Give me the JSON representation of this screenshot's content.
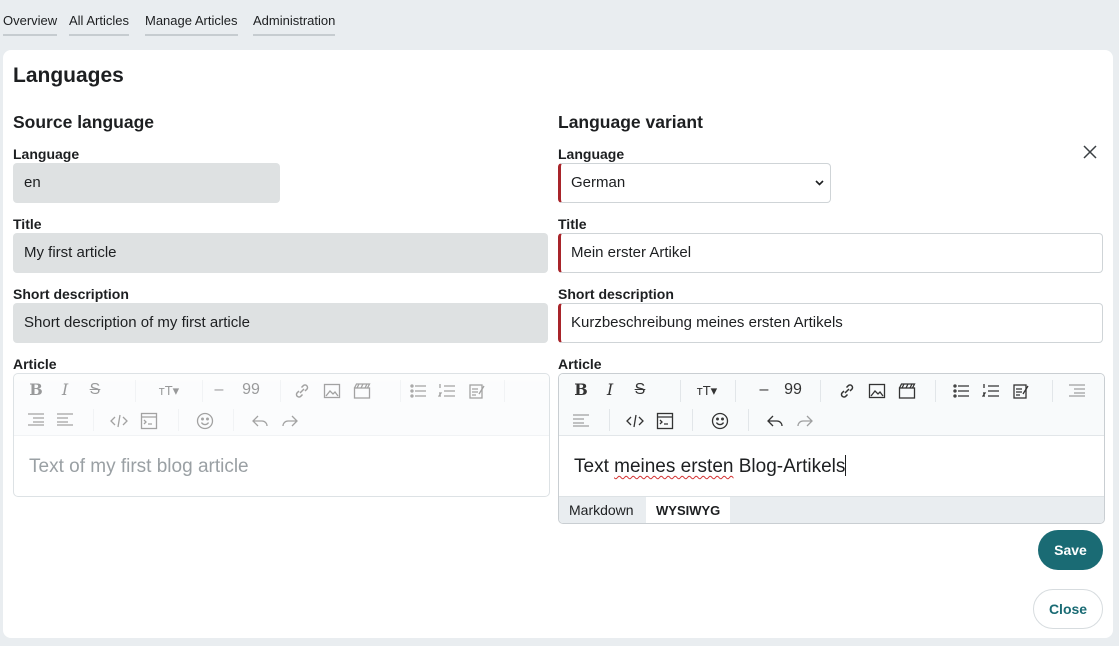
{
  "nav": {
    "items": [
      {
        "label": "Overview"
      },
      {
        "label": "All Articles"
      },
      {
        "label": "Manage Articles"
      },
      {
        "label": "Administration"
      }
    ]
  },
  "page_title": "Languages",
  "source": {
    "heading": "Source language",
    "language_label": "Language",
    "language_value": "en",
    "title_label": "Title",
    "title_value": "My first article",
    "short_label": "Short description",
    "short_value": "Short description of my first article",
    "article_label": "Article",
    "article_text": "Text of my first blog article"
  },
  "variant": {
    "heading": "Language variant",
    "language_label": "Language",
    "language_value": "German",
    "title_label": "Title",
    "title_value": "Mein erster Artikel",
    "short_label": "Short description",
    "short_value": "Kurzbeschreibung meines ersten Artikels",
    "article_label": "Article",
    "article_text_1": "Text ",
    "article_text_2": "meines ersten",
    "article_text_3": " Blog-Artikels",
    "mode_markdown": "Markdown",
    "mode_wysiwyg": "WYSIWYG"
  },
  "buttons": {
    "save": "Save",
    "close": "Close"
  },
  "colors": {
    "accent": "#1a6b74",
    "required_marker": "#a8242a",
    "readonly_bg": "#dee1e2"
  }
}
